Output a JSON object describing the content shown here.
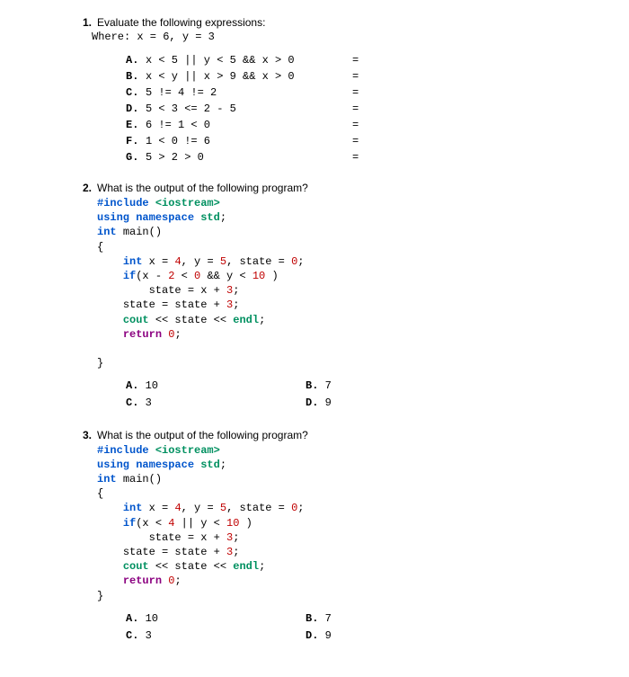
{
  "q1": {
    "num": "1.",
    "text": "Evaluate the following expressions:",
    "where": "Where: x = 6, y = 3",
    "items": [
      {
        "label": "A.",
        "expr": "x < 5 || y < 5 && x > 0",
        "eq": "="
      },
      {
        "label": "B.",
        "expr": "x < y || x > 9 && x > 0",
        "eq": "="
      },
      {
        "label": "C.",
        "expr": "5 != 4 != 2",
        "eq": "="
      },
      {
        "label": "D.",
        "expr": "5 < 3 <= 2 - 5",
        "eq": "="
      },
      {
        "label": "E.",
        "expr": "6 != 1 < 0",
        "eq": "="
      },
      {
        "label": "F.",
        "expr": "1 < 0 != 6",
        "eq": "="
      },
      {
        "label": "G.",
        "expr": "5 > 2 > 0",
        "eq": "="
      }
    ]
  },
  "q2": {
    "num": "2.",
    "text": "What is the output of the following program?",
    "options": {
      "a": {
        "label": "A.",
        "val": "10"
      },
      "b": {
        "label": "B.",
        "val": "7"
      },
      "c": {
        "label": "C.",
        "val": "3"
      },
      "d": {
        "label": "D.",
        "val": "9"
      }
    }
  },
  "q3": {
    "num": "3.",
    "text": "What is the output of the following program?",
    "options": {
      "a": {
        "label": "A.",
        "val": "10"
      },
      "b": {
        "label": "B.",
        "val": "7"
      },
      "c": {
        "label": "C.",
        "val": "3"
      },
      "d": {
        "label": "D.",
        "val": "9"
      }
    }
  },
  "code_tokens": {
    "include": "#include",
    "iostream": "<iostream>",
    "using": "using",
    "namespace": "namespace",
    "std": "std",
    "int": "int",
    "main": "main()",
    "lbrace": "{",
    "rbrace": "}",
    "decl_q2": "x = ",
    "four": "4",
    "comma_y": ", y = ",
    "five": "5",
    "comma_state": ", state = ",
    "zero": "0",
    "semi": ";",
    "if": "if",
    "cond_q2": "(x - ",
    "two": "2",
    "lt0": " < ",
    "and_y": " && y < ",
    "ten": "10",
    "rpar": " )",
    "state_eq_x3": "state = x + ",
    "three": "3",
    "state_plus3": "state = state + ",
    "cout": "cout",
    "ll_state": " << state << ",
    "endl": "endl",
    "return": "return",
    "cond_q3_a": "(x < ",
    "cond_q3_b": " || y < "
  }
}
